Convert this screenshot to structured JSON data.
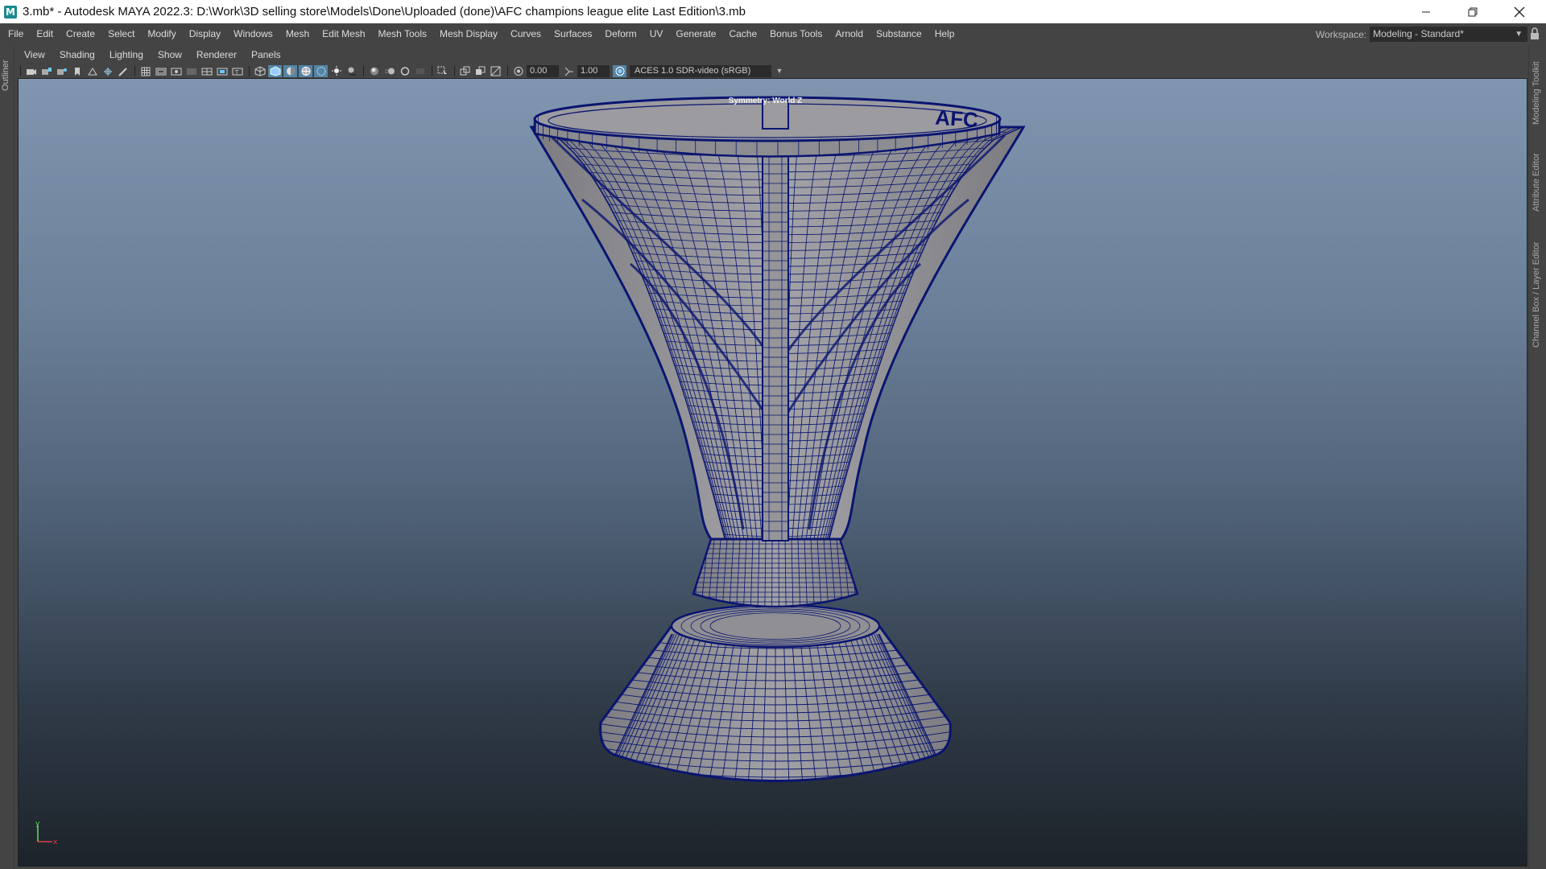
{
  "window": {
    "title": "3.mb* - Autodesk MAYA 2022.3: D:\\Work\\3D selling store\\Models\\Done\\Uploaded (done)\\AFC champions league elite Last Edition\\3.mb",
    "logo_letter": "M"
  },
  "menubar": {
    "items": [
      "File",
      "Edit",
      "Create",
      "Select",
      "Modify",
      "Display",
      "Windows",
      "Mesh",
      "Edit Mesh",
      "Mesh Tools",
      "Mesh Display",
      "Curves",
      "Surfaces",
      "Deform",
      "UV",
      "Generate",
      "Cache",
      "Bonus Tools",
      "Arnold",
      "Substance",
      "Help"
    ]
  },
  "workspace": {
    "label": "Workspace:",
    "value": "Modeling - Standard*"
  },
  "side_tabs": {
    "left": "Outliner",
    "right": [
      "Modeling Toolkit",
      "Attribute Editor",
      "Channel Box / Layer Editor"
    ]
  },
  "panel_menu": {
    "items": [
      "View",
      "Shading",
      "Lighting",
      "Show",
      "Renderer",
      "Panels"
    ]
  },
  "panel_toolbar": {
    "exposure": "0.00",
    "gamma": "1.00",
    "color_space": "ACES 1.0 SDR-video (sRGB)"
  },
  "viewport": {
    "symmetry_label": "Symmetry: World Z",
    "rim_text": "AFC",
    "axis_labels": [
      "y",
      "x"
    ],
    "colors": {
      "wire": "#0a1570",
      "surface": "#9a9a9e",
      "bg_top": "#8096b0",
      "bg_bottom": "#1d232a"
    }
  }
}
